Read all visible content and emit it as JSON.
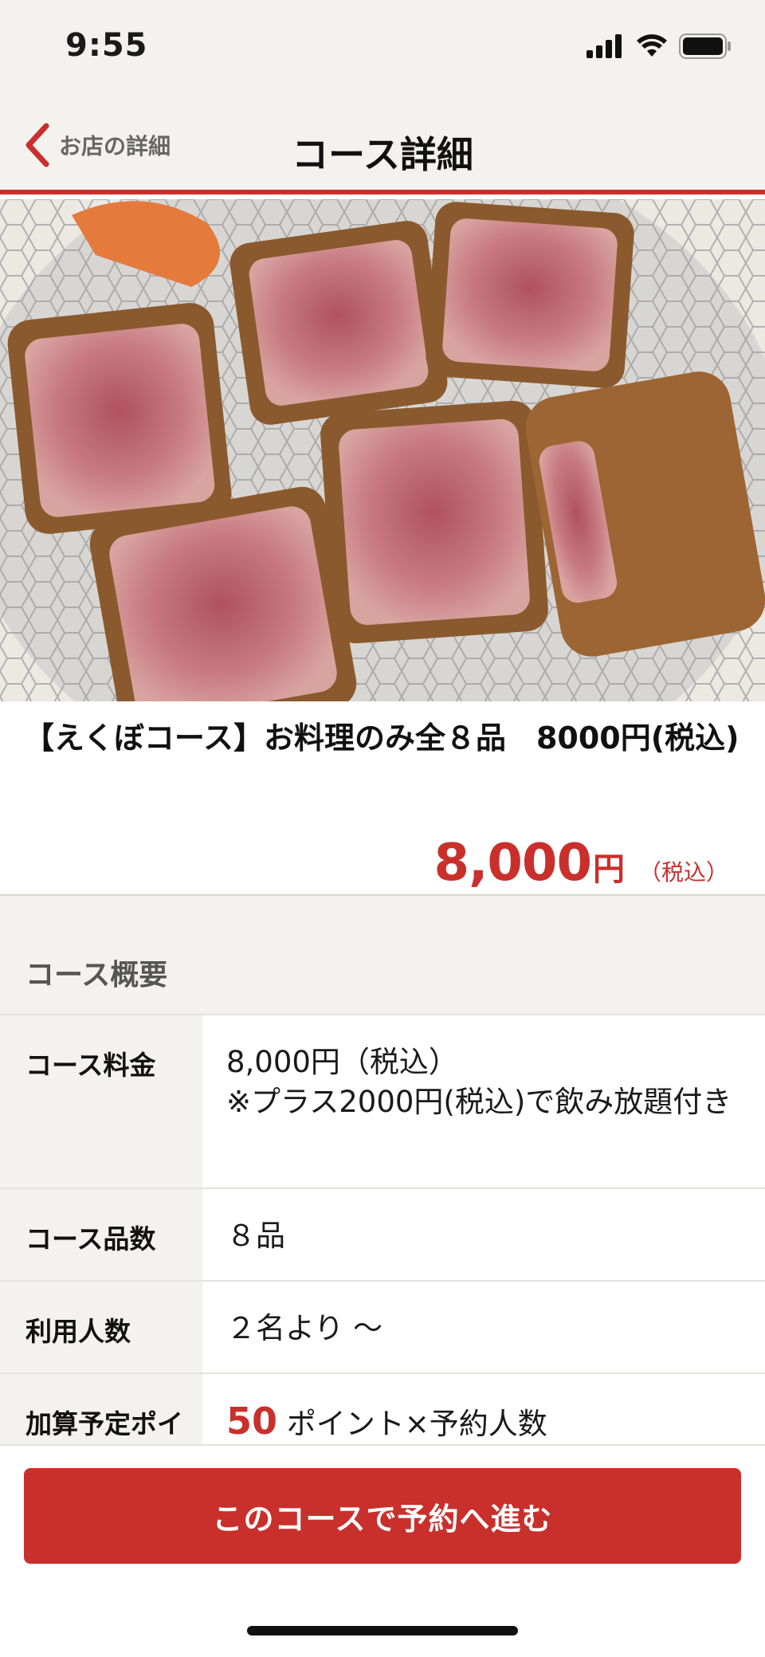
{
  "status_bar": {
    "time": "9:55"
  },
  "nav": {
    "back_label": "お店の詳細",
    "title": "コース詳細"
  },
  "course": {
    "title": "【えくぼコース】お料理のみ全８品　8000円(税込)",
    "price": "8,000",
    "price_unit": "円",
    "price_tax": "（税込）"
  },
  "section": {
    "title": "コース概要"
  },
  "details": {
    "fee_label": "コース料金",
    "fee_line1": "8,000円（税込）",
    "fee_line2": "※プラス2000円(税込)で飲み放題付き",
    "items_label": "コース品数",
    "items_value": "８品",
    "people_label": "利用人数",
    "people_value": "２名より ～",
    "points_label": "加算予定ポイント",
    "points_value": "50",
    "points_suffix": " ポイント×予約人数"
  },
  "cta": {
    "label": "このコースで予約へ進む"
  },
  "colors": {
    "accent": "#c9302c",
    "header_bg": "#f4f2ee"
  }
}
